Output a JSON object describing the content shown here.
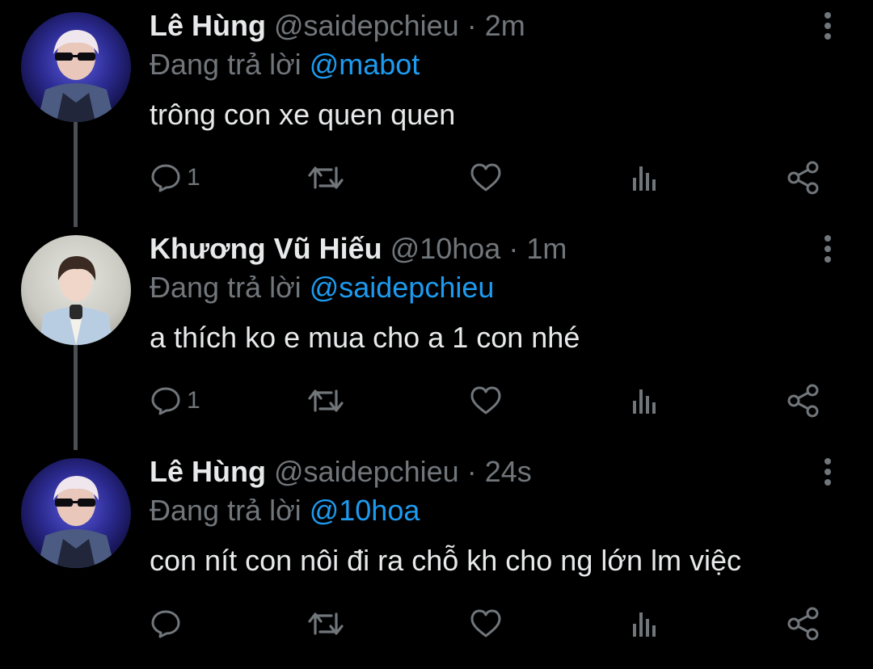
{
  "theme": {
    "background": "#000000",
    "text": "#e7e9ea",
    "muted": "#71767b",
    "accent": "#1d9bf0",
    "thread_line": "#4a4f55"
  },
  "tweets": [
    {
      "author": "Lê Hùng",
      "handle": "@saidepchieu",
      "separator": "·",
      "time": "2m",
      "reply_prefix": "Đang trả lời",
      "reply_to": "@mabot",
      "text": "trông con xe quen quen",
      "reply_count": "1",
      "icons": [
        "reply-icon",
        "retweet-icon",
        "like-icon",
        "views-icon",
        "share-icon",
        "more-icon"
      ]
    },
    {
      "author": "Khương Vũ Hiếu",
      "handle": "@10hoa",
      "separator": "·",
      "time": "1m",
      "reply_prefix": "Đang trả lời",
      "reply_to": "@saidepchieu",
      "text": "a thích ko e mua cho a 1 con nhé",
      "reply_count": "1",
      "icons": [
        "reply-icon",
        "retweet-icon",
        "like-icon",
        "views-icon",
        "share-icon",
        "more-icon"
      ]
    },
    {
      "author": "Lê Hùng",
      "handle": "@saidepchieu",
      "separator": "·",
      "time": "24s",
      "reply_prefix": "Đang trả lời",
      "reply_to": "@10hoa",
      "text": "con nít con nôi đi ra chỗ kh cho ng lớn lm việc",
      "reply_count": "",
      "icons": [
        "reply-icon",
        "retweet-icon",
        "like-icon",
        "views-icon",
        "share-icon",
        "more-icon"
      ]
    }
  ]
}
